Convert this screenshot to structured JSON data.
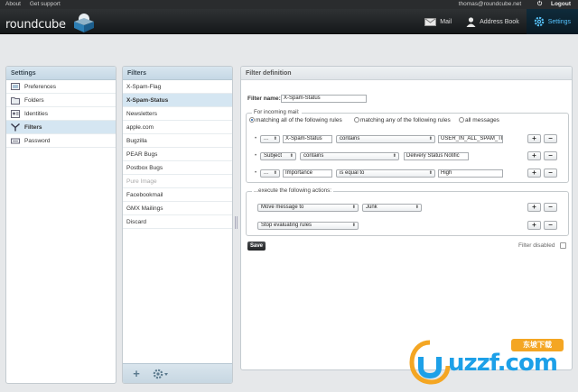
{
  "topbar": {
    "about": "About",
    "support": "Get support",
    "user": "thomas@roundcube.net",
    "logout": "Logout"
  },
  "header": {
    "logo_text": "roundcube",
    "nav": [
      {
        "label": "Mail",
        "icon": "mail-icon"
      },
      {
        "label": "Address Book",
        "icon": "address-book-icon"
      },
      {
        "label": "Settings",
        "icon": "gear-icon",
        "active": true
      }
    ]
  },
  "settings": {
    "title": "Settings",
    "items": [
      {
        "label": "Preferences",
        "icon": "preferences-icon"
      },
      {
        "label": "Folders",
        "icon": "folder-icon"
      },
      {
        "label": "Identities",
        "icon": "identity-icon"
      },
      {
        "label": "Filters",
        "icon": "filter-icon",
        "selected": true
      },
      {
        "label": "Password",
        "icon": "key-icon"
      }
    ]
  },
  "filters": {
    "title": "Filters",
    "items": [
      {
        "label": "X-Spam-Flag"
      },
      {
        "label": "X-Spam-Status",
        "selected": true
      },
      {
        "label": "Newsletters"
      },
      {
        "label": "apple.com"
      },
      {
        "label": "Bugzilla"
      },
      {
        "label": "PEAR Bugs"
      },
      {
        "label": "Postbox Bugs"
      },
      {
        "label": "Pure Image",
        "disabled": true
      },
      {
        "label": "Facebookmail"
      },
      {
        "label": "GMX Mailings"
      },
      {
        "label": "Discard"
      }
    ],
    "add_label": "+"
  },
  "definition": {
    "title": "Filter definition",
    "name_label": "Filter name:",
    "name_value": "X-Spam-Status",
    "incoming": {
      "legend": "For incoming mail:",
      "options": [
        {
          "label": "matching all of the following rules",
          "checked": true
        },
        {
          "label": "matching any of the following rules",
          "checked": false
        },
        {
          "label": "all messages",
          "checked": false
        }
      ],
      "rules": [
        {
          "header": "...",
          "header_text": "X-Spam-Status",
          "op": "contains",
          "value": "USER_IN_ALL_SPAM_TI"
        },
        {
          "header": "Subject",
          "header_text": "",
          "op": "contains",
          "value": "Delivery Status Notific"
        },
        {
          "header": "...",
          "header_text": "Importance",
          "op": "is equal to",
          "value": "High"
        }
      ]
    },
    "actions": {
      "legend": "...execute the following actions:",
      "rows": [
        {
          "action": "Move message to",
          "target": "Junk"
        },
        {
          "action": "Stop evaluating rules",
          "target": ""
        }
      ]
    },
    "plus": "+",
    "minus": "−",
    "bullet": "•",
    "save_label": "Save",
    "disabled_label": "Filter disabled"
  },
  "watermark": {
    "text": "uzzf.com",
    "tag": "东坡下载"
  },
  "colors": {
    "accent": "#57c4ff",
    "selected_bg": "#d5e6f2",
    "header_bg": "#1a1c1e"
  }
}
